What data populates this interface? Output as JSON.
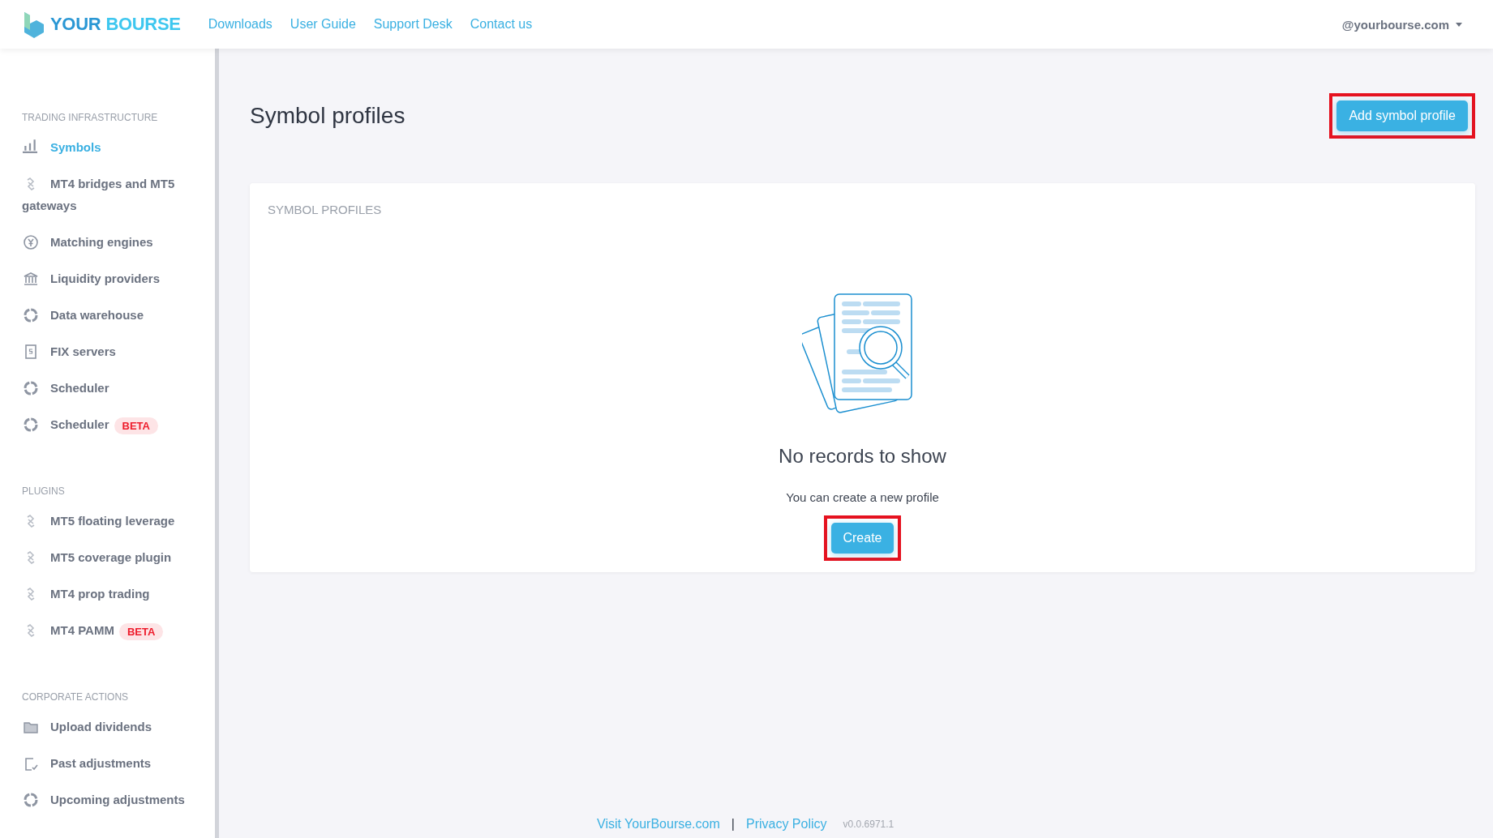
{
  "header": {
    "logo": {
      "first": "YOUR",
      "second": "BOURSE"
    },
    "nav": [
      {
        "label": "Downloads"
      },
      {
        "label": "User Guide"
      },
      {
        "label": "Support Desk"
      },
      {
        "label": "Contact us"
      }
    ],
    "user": "@yourbourse.com"
  },
  "sidebar": {
    "sections": [
      {
        "title": "TRADING INFRASTRUCTURE",
        "items": [
          {
            "label": "Symbols",
            "selected": true
          },
          {
            "label": "MT4 bridges and MT5 gateways",
            "selected": false
          },
          {
            "label": "Matching engines",
            "selected": false
          },
          {
            "label": "Liquidity providers",
            "selected": false
          },
          {
            "label": "Data warehouse",
            "selected": false
          },
          {
            "label": "FIX servers",
            "selected": false
          },
          {
            "label": "Scheduler",
            "selected": false
          },
          {
            "label": "Scheduler",
            "selected": false,
            "badge": "BETA"
          }
        ]
      },
      {
        "title": "PLUGINS",
        "items": [
          {
            "label": "MT5 floating leverage",
            "selected": false
          },
          {
            "label": "MT5 coverage plugin",
            "selected": false
          },
          {
            "label": "MT4 prop trading",
            "selected": false
          },
          {
            "label": "MT4 PAMM",
            "selected": false,
            "badge": "BETA"
          }
        ]
      },
      {
        "title": "CORPORATE ACTIONS",
        "items": [
          {
            "label": "Upload dividends",
            "selected": false
          },
          {
            "label": "Past adjustments",
            "selected": false
          },
          {
            "label": "Upcoming adjustments",
            "selected": false
          }
        ]
      }
    ]
  },
  "page": {
    "title": "Symbol profiles",
    "add_button": {
      "label": "Add symbol profile",
      "highlighted": true
    }
  },
  "card": {
    "title": "SYMBOL PROFILES",
    "empty_title": "No records to show",
    "empty_text": "You can create a new profile",
    "create_button": {
      "label": "Create",
      "highlighted": true
    }
  },
  "footer": {
    "links": [
      {
        "label": "Visit YourBourse.com"
      },
      {
        "label": "Privacy Policy"
      }
    ],
    "separator": "|",
    "version": "v0.0.6971.1"
  }
}
